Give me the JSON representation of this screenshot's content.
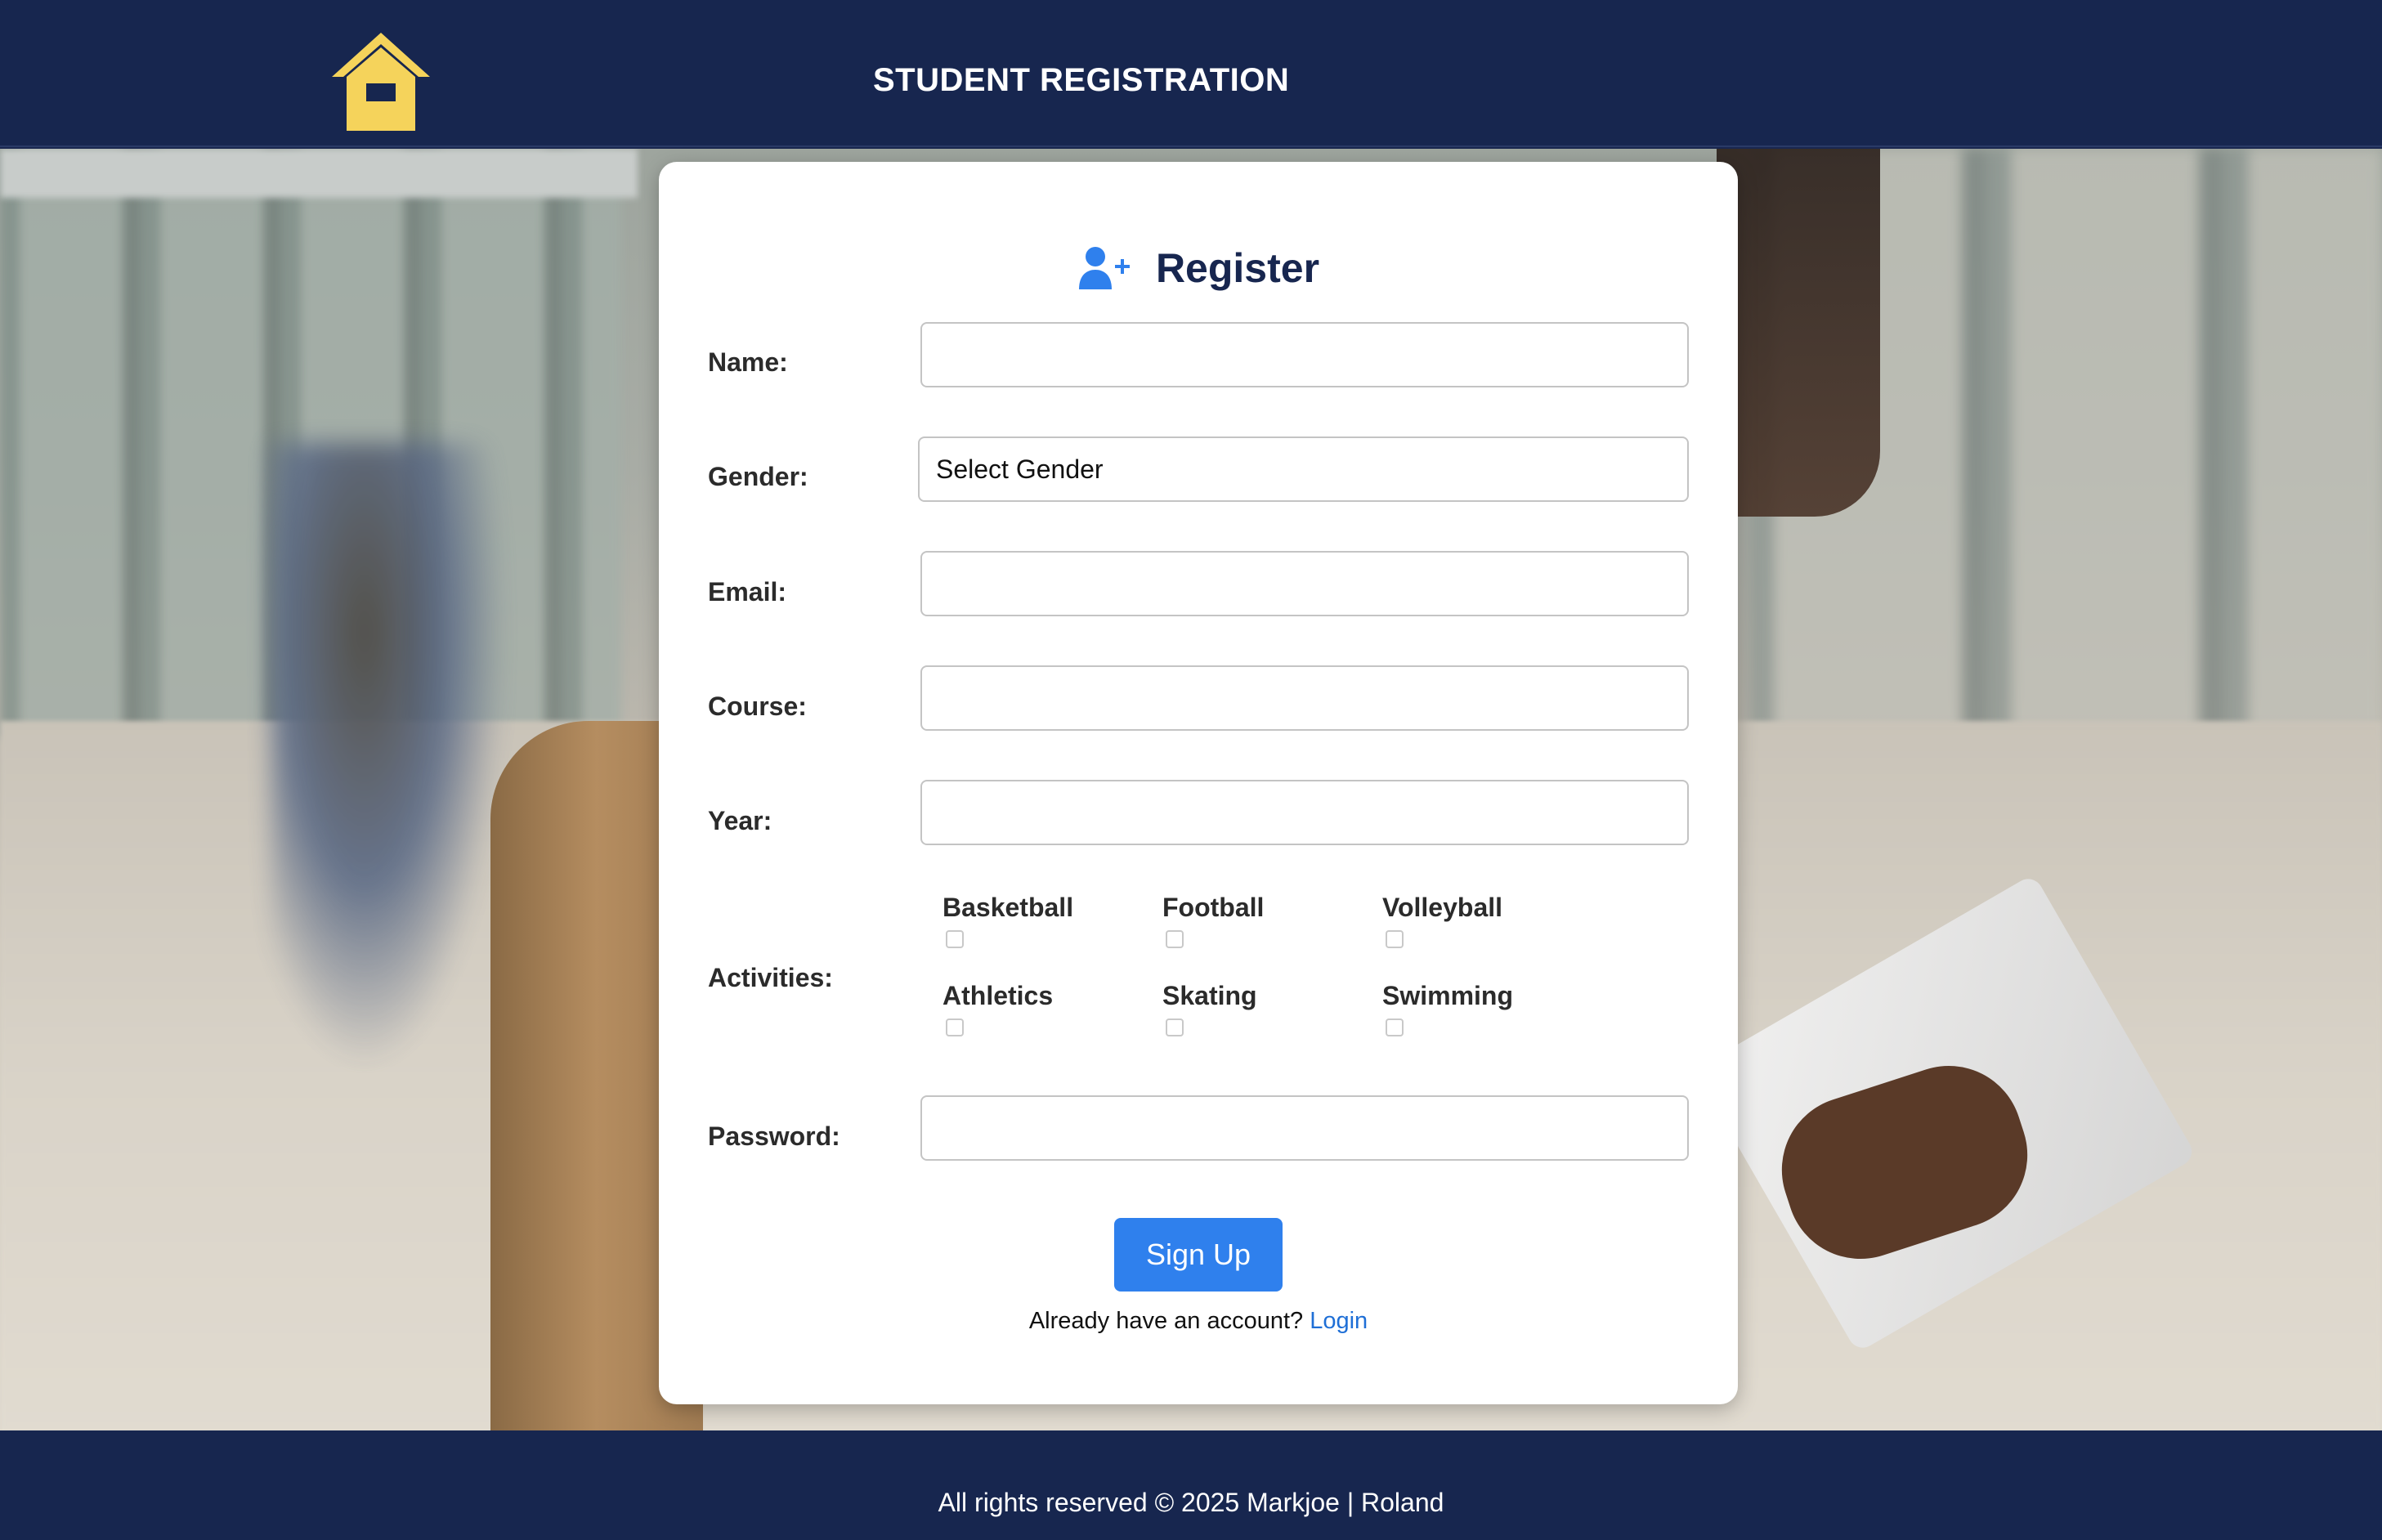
{
  "header": {
    "home_icon": "home-icon",
    "title": "STUDENT REGISTRATION"
  },
  "form": {
    "title": "Register",
    "title_icon": "user-plus-icon",
    "fields": {
      "name": {
        "label": "Name:",
        "value": ""
      },
      "gender": {
        "label": "Gender:",
        "selected": "Select Gender"
      },
      "email": {
        "label": "Email:",
        "value": ""
      },
      "course": {
        "label": "Course:",
        "value": ""
      },
      "year": {
        "label": "Year:",
        "value": ""
      },
      "password": {
        "label": "Password:",
        "value": ""
      }
    },
    "activities": {
      "label": "Activities:",
      "options": [
        "Basketball",
        "Football",
        "Volleyball",
        "Athletics",
        "Skating",
        "Swimming"
      ]
    },
    "submit_label": "Sign Up",
    "login_prompt": "Already have an account?",
    "login_link": "Login"
  },
  "footer": {
    "text": "All rights reserved © 2025 Markjoe | Roland"
  },
  "colors": {
    "navy": "#17264f",
    "accent_blue": "#2f80ed",
    "home_icon_yellow": "#f5d35b"
  }
}
